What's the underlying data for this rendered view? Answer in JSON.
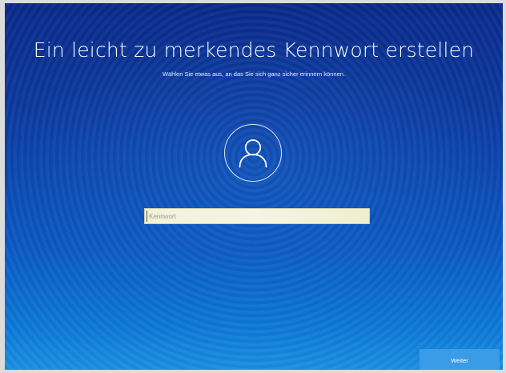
{
  "page": {
    "title": "Ein leicht zu merkendes Kennwort erstellen",
    "subtitle": "Wählen Sie etwas aus, an das Sie sich ganz sicher erinnern können."
  },
  "password_field": {
    "placeholder": "Kennwort",
    "value": ""
  },
  "avatar": {
    "icon": "user-icon"
  },
  "footer": {
    "next_label": "Weiter"
  },
  "colors": {
    "background_top": "#0a2a8a",
    "background_bottom": "#1a8fe2",
    "button": "#3a9be6",
    "field": "#f0f2d8",
    "text": "#ffffff"
  }
}
